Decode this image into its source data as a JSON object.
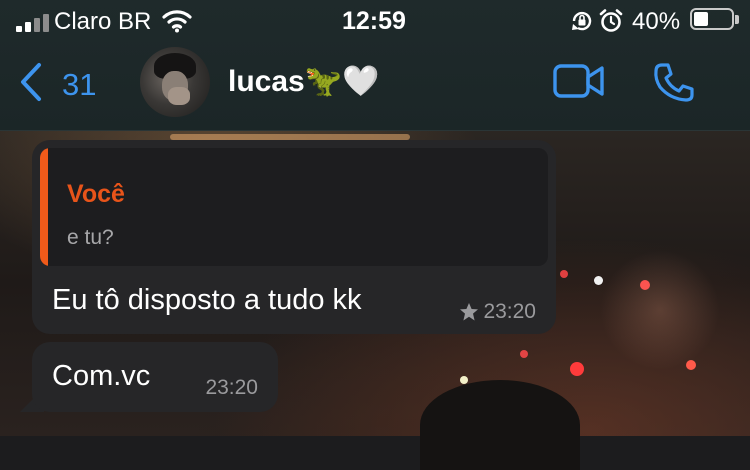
{
  "status_bar": {
    "carrier": "Claro BR",
    "time": "12:59",
    "battery_percent": "40%",
    "battery_level": 0.4
  },
  "header": {
    "back_count": "31",
    "contact_name": "lucas🦖🤍",
    "accent_color": "#3d94ee"
  },
  "messages": [
    {
      "quote_author": "Você",
      "quote_text": "e tu?",
      "quote_color": "#ef5a1a",
      "text": "Eu tô disposto a tudo kk",
      "time": "23:20",
      "starred": true
    },
    {
      "text": "Com.vc",
      "time": "23:20",
      "starred": false
    }
  ],
  "icons": [
    "signal-icon",
    "wifi-icon",
    "rotation-lock-icon",
    "alarm-icon",
    "battery-icon",
    "chevron-left-icon",
    "video-camera-icon",
    "phone-icon",
    "star-icon"
  ]
}
